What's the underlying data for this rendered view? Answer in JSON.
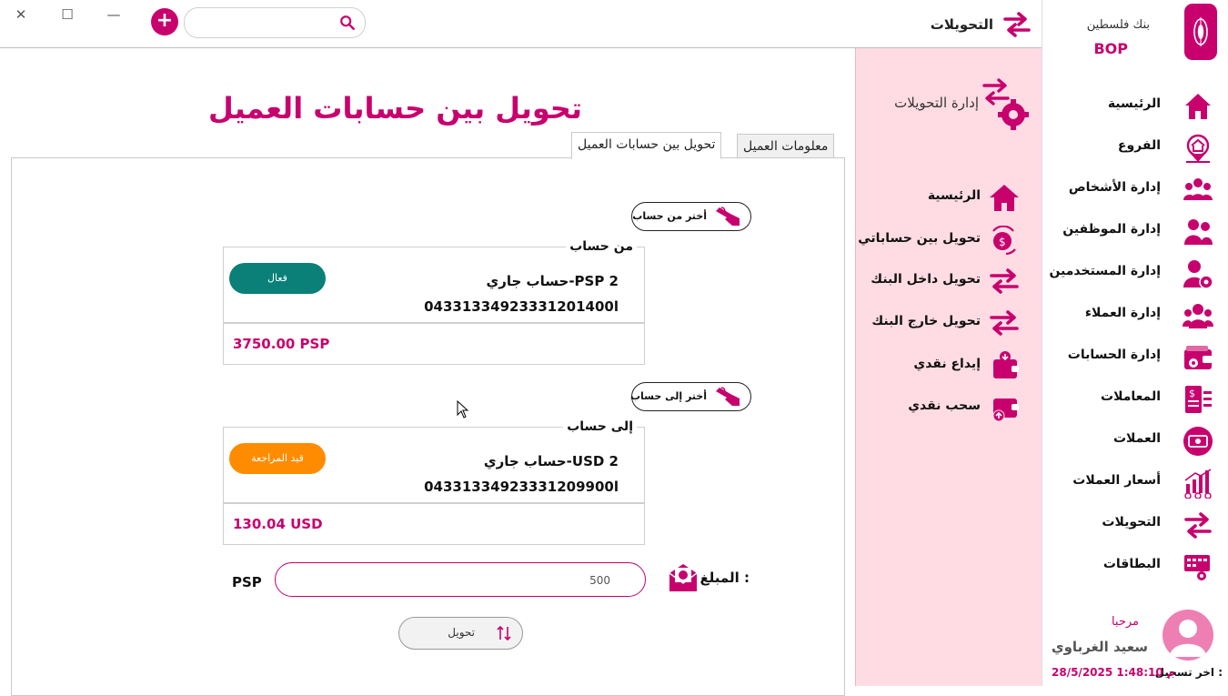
{
  "window": {
    "close_icon": "close-icon",
    "maximize_icon": "maximize-icon",
    "minimize_icon": "minimize-icon",
    "close_glyph": "✕",
    "maximize_glyph": "☐",
    "minimize_glyph": "—"
  },
  "topbar": {
    "title": "التحويلات",
    "add_glyph": "+",
    "search_value": "",
    "search_placeholder": ""
  },
  "sidebar": {
    "bank_name": "بنك فلسطين",
    "bank_abbr": "BOP",
    "items": [
      {
        "label": "الرئيسية",
        "icon": "home-icon"
      },
      {
        "label": "الفروع",
        "icon": "branch-location-icon"
      },
      {
        "label": "إدارة الأشخاص",
        "icon": "people-group-icon"
      },
      {
        "label": "إدارة الموظفين",
        "icon": "employees-icon"
      },
      {
        "label": "إدارة المستخدمين",
        "icon": "user-settings-icon"
      },
      {
        "label": "إدارة العملاء",
        "icon": "clients-icon"
      },
      {
        "label": "إدارة الحسابات",
        "icon": "wallet-settings-icon"
      },
      {
        "label": "المعاملات",
        "icon": "transactions-icon"
      },
      {
        "label": "العملات",
        "icon": "currency-icon"
      },
      {
        "label": "أسعار العملات",
        "icon": "exchange-rates-icon"
      },
      {
        "label": "التحويلات",
        "icon": "transfer-arrows-icon"
      },
      {
        "label": "البطاقات",
        "icon": "cards-icon"
      }
    ],
    "welcome": "مرحبا",
    "username": "سعيد الغرباوي",
    "last_login_label": "اخر تسجيل :",
    "last_login_value": "28/5/2025 1:48:10 م"
  },
  "subpanel": {
    "title": "إدارة التحويلات",
    "items": [
      {
        "label": "الرئيسية",
        "icon": "home-icon"
      },
      {
        "label": "تحويل بين حساباتي",
        "icon": "money-exchange-icon"
      },
      {
        "label": "تحويل داخل البنك",
        "icon": "transfer-arrows-icon"
      },
      {
        "label": "تحويل خارج البنك",
        "icon": "transfer-arrows-icon"
      },
      {
        "label": "إيداع نقدي",
        "icon": "cash-deposit-icon"
      },
      {
        "label": "سحب نقدي",
        "icon": "cash-withdraw-icon"
      }
    ]
  },
  "main": {
    "title": "تحويل بين حسابات العميل",
    "tabs": [
      {
        "label": "معلومات العميل",
        "active": false
      },
      {
        "label": "تحويل بين حسابات العميل",
        "active": true
      }
    ],
    "from": {
      "pick_label": "أختر من حساب",
      "legend": "من حساب",
      "account_name": "حساب جاري-PSP 2",
      "account_number": "04331334923331201400l",
      "status": "فعال",
      "status_color": "#0a8078",
      "balance": "3750.00 PSP"
    },
    "to": {
      "pick_label": "أختر إلى حساب",
      "legend": "إلى حساب",
      "account_name": "حساب جاري-USD 2",
      "account_number": "04331334923331209900l",
      "status": "قيد المراجعة",
      "status_color": "#ff8c00",
      "balance": "130.04 USD"
    },
    "amount_label": "المبلغ :",
    "amount_value": "500",
    "amount_currency": "PSP",
    "transfer_label": "تحويل"
  },
  "colors": {
    "brand": "#c8006e",
    "panel_pink": "#ffdce4"
  }
}
